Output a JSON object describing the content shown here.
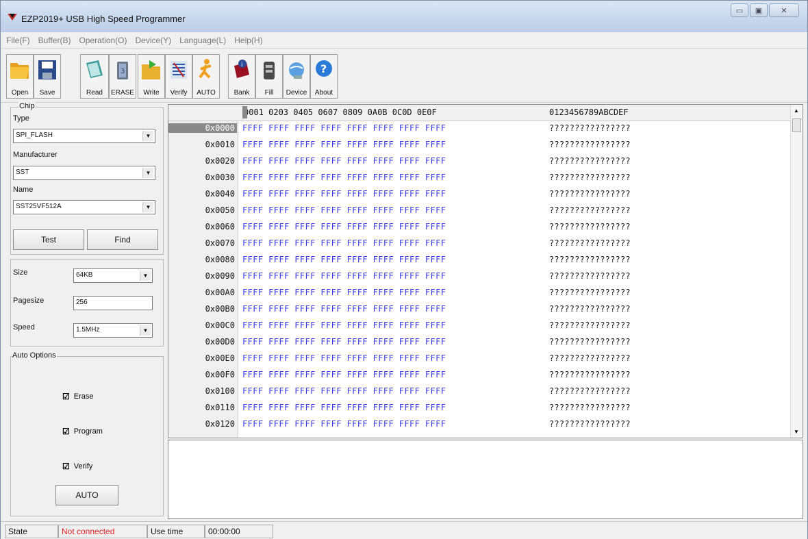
{
  "window": {
    "title": "EZP2019+ USB High Speed Programmer"
  },
  "menu": [
    "File(F)",
    "Buffer(B)",
    "Operation(O)",
    "Device(Y)",
    "Language(L)",
    "Help(H)"
  ],
  "toolbar": [
    {
      "label": "Open",
      "icon": "folder-open-icon"
    },
    {
      "label": "Save",
      "icon": "floppy-save-icon"
    },
    {
      "label": "Read",
      "icon": "book-read-icon"
    },
    {
      "label": "ERASE",
      "icon": "trash-erase-icon"
    },
    {
      "label": "Write",
      "icon": "folder-write-icon"
    },
    {
      "label": "Verify",
      "icon": "verify-grid-icon"
    },
    {
      "label": "AUTO",
      "icon": "running-man-icon"
    },
    {
      "label": "Bank",
      "icon": "bank-book-icon"
    },
    {
      "label": "Fill",
      "icon": "fill-bucket-icon"
    },
    {
      "label": "Device",
      "icon": "device-globe-icon"
    },
    {
      "label": "About",
      "icon": "about-question-icon"
    }
  ],
  "chip": {
    "group_label": "Chip",
    "type_label": "Type",
    "type_value": "SPI_FLASH",
    "manufacturer_label": "Manufacturer",
    "manufacturer_value": "SST",
    "name_label": "Name",
    "name_value": "SST25VF512A",
    "test_button": "Test",
    "find_button": "Find"
  },
  "params": {
    "size_label": "Size",
    "size_value": "64KB",
    "pagesize_label": "Pagesize",
    "pagesize_value": "256",
    "speed_label": "Speed",
    "speed_value": "1.5MHz"
  },
  "auto_options": {
    "group_label": "Auto Options",
    "erase": "Erase",
    "program": "Program",
    "verify": "Verify",
    "auto_button": "AUTO"
  },
  "hex": {
    "header_offsets": "0001 0203 0405 0607 0809 0A0B 0C0D 0E0F",
    "header_ascii": "0123456789ABCDEF",
    "rows": [
      {
        "addr": "0x0000",
        "hex": "FFFF FFFF FFFF FFFF FFFF FFFF FFFF FFFF",
        "ascii": "????????????????"
      },
      {
        "addr": "0x0010",
        "hex": "FFFF FFFF FFFF FFFF FFFF FFFF FFFF FFFF",
        "ascii": "????????????????"
      },
      {
        "addr": "0x0020",
        "hex": "FFFF FFFF FFFF FFFF FFFF FFFF FFFF FFFF",
        "ascii": "????????????????"
      },
      {
        "addr": "0x0030",
        "hex": "FFFF FFFF FFFF FFFF FFFF FFFF FFFF FFFF",
        "ascii": "????????????????"
      },
      {
        "addr": "0x0040",
        "hex": "FFFF FFFF FFFF FFFF FFFF FFFF FFFF FFFF",
        "ascii": "????????????????"
      },
      {
        "addr": "0x0050",
        "hex": "FFFF FFFF FFFF FFFF FFFF FFFF FFFF FFFF",
        "ascii": "????????????????"
      },
      {
        "addr": "0x0060",
        "hex": "FFFF FFFF FFFF FFFF FFFF FFFF FFFF FFFF",
        "ascii": "????????????????"
      },
      {
        "addr": "0x0070",
        "hex": "FFFF FFFF FFFF FFFF FFFF FFFF FFFF FFFF",
        "ascii": "????????????????"
      },
      {
        "addr": "0x0080",
        "hex": "FFFF FFFF FFFF FFFF FFFF FFFF FFFF FFFF",
        "ascii": "????????????????"
      },
      {
        "addr": "0x0090",
        "hex": "FFFF FFFF FFFF FFFF FFFF FFFF FFFF FFFF",
        "ascii": "????????????????"
      },
      {
        "addr": "0x00A0",
        "hex": "FFFF FFFF FFFF FFFF FFFF FFFF FFFF FFFF",
        "ascii": "????????????????"
      },
      {
        "addr": "0x00B0",
        "hex": "FFFF FFFF FFFF FFFF FFFF FFFF FFFF FFFF",
        "ascii": "????????????????"
      },
      {
        "addr": "0x00C0",
        "hex": "FFFF FFFF FFFF FFFF FFFF FFFF FFFF FFFF",
        "ascii": "????????????????"
      },
      {
        "addr": "0x00D0",
        "hex": "FFFF FFFF FFFF FFFF FFFF FFFF FFFF FFFF",
        "ascii": "????????????????"
      },
      {
        "addr": "0x00E0",
        "hex": "FFFF FFFF FFFF FFFF FFFF FFFF FFFF FFFF",
        "ascii": "????????????????"
      },
      {
        "addr": "0x00F0",
        "hex": "FFFF FFFF FFFF FFFF FFFF FFFF FFFF FFFF",
        "ascii": "????????????????"
      },
      {
        "addr": "0x0100",
        "hex": "FFFF FFFF FFFF FFFF FFFF FFFF FFFF FFFF",
        "ascii": "????????????????"
      },
      {
        "addr": "0x0110",
        "hex": "FFFF FFFF FFFF FFFF FFFF FFFF FFFF FFFF",
        "ascii": "????????????????"
      },
      {
        "addr": "0x0120",
        "hex": "FFFF FFFF FFFF FFFF FFFF FFFF FFFF FFFF",
        "ascii": "????????????????"
      }
    ]
  },
  "status": {
    "state_label": "State",
    "state_value": "Not connected",
    "use_time_label": "Use time",
    "use_time_value": "00:00:00"
  },
  "colors": {
    "hex_text": "#3a3ae0",
    "not_connected": "#e02020",
    "title_gradient": "#c6d6ec"
  }
}
